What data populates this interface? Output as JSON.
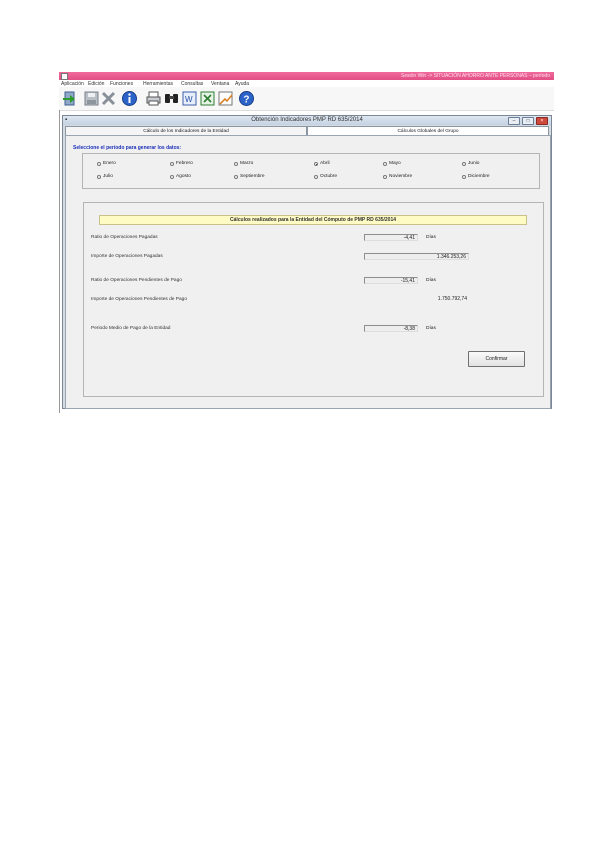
{
  "app": {
    "title": "Sesión Win -> SITUACIÓN AHORRO ANTE PERSONAS – período",
    "menu": [
      "Aplicación",
      "Edición",
      "Funciones",
      "Herramientas",
      "Consultas",
      "Ventana",
      "Ayuda"
    ],
    "toolbar": [
      "exit-icon",
      "save-icon",
      "delete-icon",
      "info-icon",
      "print-icon",
      "find-icon",
      "word-export-icon",
      "excel-export-icon",
      "chart-icon",
      "help-icon"
    ]
  },
  "window": {
    "title": "Obtención Indicadores PMP RD 635/2014",
    "tabs": [
      "Cálculo de los Indicadores de la Entidad",
      "Cálculos Globales del Grupo"
    ]
  },
  "period": {
    "label": "Seleccione el período para generar los datos:",
    "months": [
      "Enero",
      "Febrero",
      "Marzo",
      "Abril",
      "Mayo",
      "Junio",
      "Julio",
      "Agosto",
      "Septiembre",
      "Octubre",
      "Noviembre",
      "Diciembre"
    ],
    "selected": "Abril"
  },
  "calc": {
    "title": "Cálculos realizados para la Entidad del Cómputo de PMP RD 635/2014",
    "rows": [
      {
        "label": "Ratio de Operaciones Pagadas",
        "value": "-4,41",
        "unit": "Días"
      },
      {
        "label": "Importe de Operaciones Pagadas",
        "value": "1.346.253,26",
        "unit": ""
      },
      {
        "label": "Ratio de Operaciones Pendientes de Pago",
        "value": "-15,41",
        "unit": "Días"
      },
      {
        "label": "Importe de Operaciones Pendientes de Pago",
        "value": "1.750.792,74",
        "unit": ""
      },
      {
        "label": "Periodo Medio de Pago de la Entidad",
        "value": "-8,38",
        "unit": "Días"
      }
    ],
    "confirm_label": "Confirmar"
  },
  "colors": {
    "titlebar": "#e85a8c",
    "calc_header": "#fffbc4",
    "period_label": "#1b2fb8"
  }
}
